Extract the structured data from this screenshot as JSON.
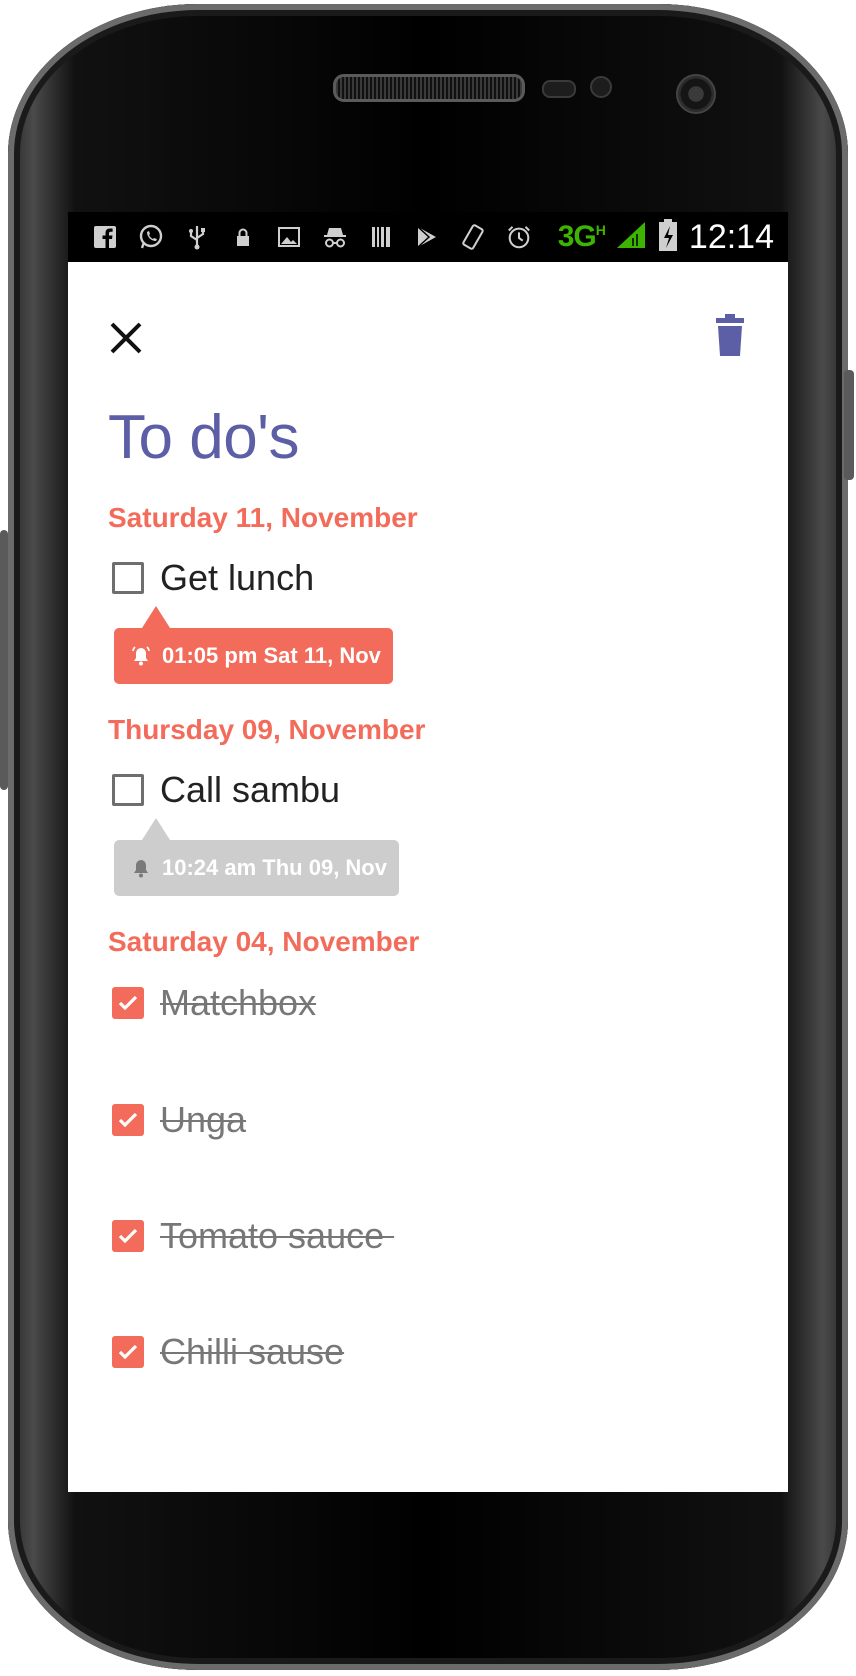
{
  "status_bar": {
    "network": "3G",
    "network_sup": "H",
    "time": "12:14",
    "icons": [
      "facebook-icon",
      "whatsapp-icon",
      "usb-icon",
      "lock-icon",
      "image-icon",
      "incognito-icon",
      "barcode-icon",
      "play-store-icon",
      "screen-rotate-icon",
      "alarm-icon",
      "signal-icon",
      "battery-charging-icon"
    ]
  },
  "toolbar": {
    "close_icon": "close-icon",
    "delete_icon": "trash-icon"
  },
  "page": {
    "title": "To do's"
  },
  "groups": [
    {
      "date": "Saturday 11, November",
      "tasks": [
        {
          "label": "Get lunch",
          "done": false,
          "reminder": "01:05 pm Sat 11, Nov",
          "reminder_active": true
        }
      ]
    },
    {
      "date": "Thursday 09, November",
      "tasks": [
        {
          "label": "Call sambu",
          "done": false,
          "reminder": "10:24 am Thu 09, Nov",
          "reminder_active": false
        }
      ]
    },
    {
      "date": "Saturday 04, November",
      "tasks": [
        {
          "label": "Matchbox",
          "done": true
        },
        {
          "label": "Unga",
          "done": true
        },
        {
          "label": "Tomato sauce ",
          "done": true
        },
        {
          "label": "Chilli sause",
          "done": true
        }
      ]
    }
  ],
  "colors": {
    "accent": "#f36b5a",
    "title": "#5c5fa5",
    "reminder_inactive": "#cdcdcd"
  }
}
